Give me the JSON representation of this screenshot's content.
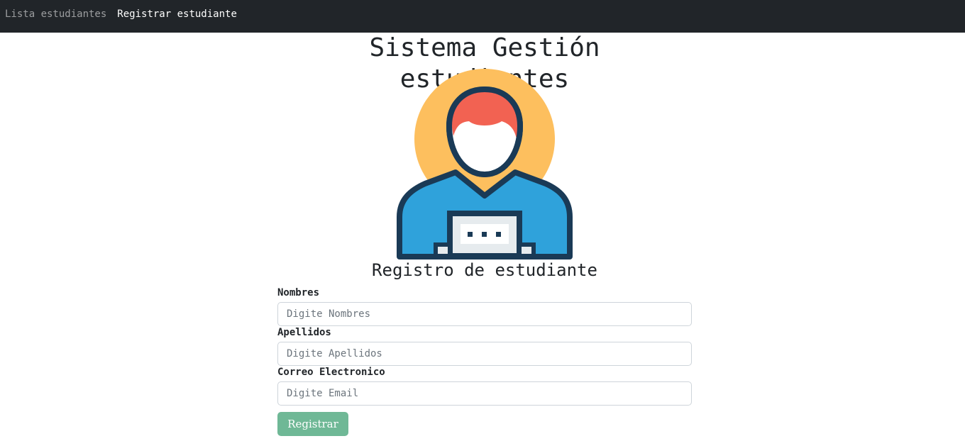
{
  "nav": {
    "items": [
      {
        "label": "Lista estudiantes",
        "active": false
      },
      {
        "label": "Registrar estudiante",
        "active": true
      }
    ]
  },
  "header": {
    "title": "Sistema Gestión estudiantes"
  },
  "avatar": {
    "icon": "student-avatar-icon",
    "colors": {
      "circle": "#fdbf5e",
      "hair": "#f26252",
      "shirt": "#2fa2db",
      "outline": "#1a3a56",
      "laptop": "#e6ebee"
    }
  },
  "form": {
    "title": "Registro de estudiante",
    "fields": [
      {
        "label": "Nombres",
        "placeholder": "Digite Nombres",
        "value": ""
      },
      {
        "label": "Apellidos",
        "placeholder": "Digite Apellidos",
        "value": ""
      },
      {
        "label": "Correo Electronico",
        "placeholder": "Digite Email",
        "value": ""
      }
    ],
    "submit_label": "Registrar",
    "submit_color": "#6fb896"
  },
  "theme": {
    "navbar_bg": "#212529"
  }
}
